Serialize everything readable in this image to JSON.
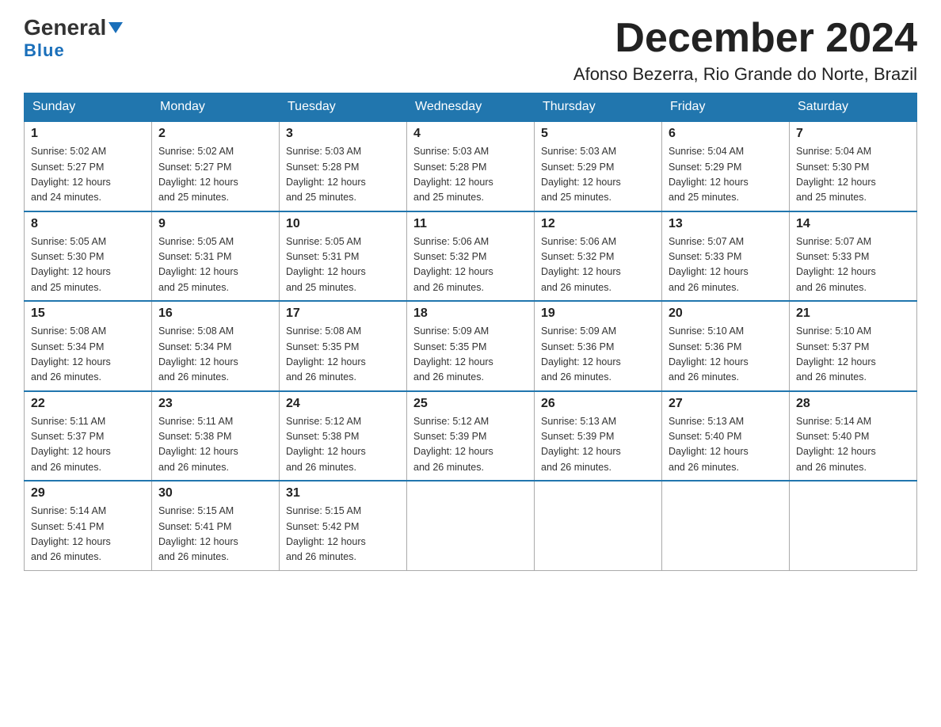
{
  "logo": {
    "line1": "General",
    "triangle": "▶",
    "line2": "Blue"
  },
  "header": {
    "month": "December 2024",
    "location": "Afonso Bezerra, Rio Grande do Norte, Brazil"
  },
  "days_of_week": [
    "Sunday",
    "Monday",
    "Tuesday",
    "Wednesday",
    "Thursday",
    "Friday",
    "Saturday"
  ],
  "weeks": [
    [
      {
        "num": "1",
        "sunrise": "5:02 AM",
        "sunset": "5:27 PM",
        "daylight": "12 hours and 24 minutes."
      },
      {
        "num": "2",
        "sunrise": "5:02 AM",
        "sunset": "5:27 PM",
        "daylight": "12 hours and 25 minutes."
      },
      {
        "num": "3",
        "sunrise": "5:03 AM",
        "sunset": "5:28 PM",
        "daylight": "12 hours and 25 minutes."
      },
      {
        "num": "4",
        "sunrise": "5:03 AM",
        "sunset": "5:28 PM",
        "daylight": "12 hours and 25 minutes."
      },
      {
        "num": "5",
        "sunrise": "5:03 AM",
        "sunset": "5:29 PM",
        "daylight": "12 hours and 25 minutes."
      },
      {
        "num": "6",
        "sunrise": "5:04 AM",
        "sunset": "5:29 PM",
        "daylight": "12 hours and 25 minutes."
      },
      {
        "num": "7",
        "sunrise": "5:04 AM",
        "sunset": "5:30 PM",
        "daylight": "12 hours and 25 minutes."
      }
    ],
    [
      {
        "num": "8",
        "sunrise": "5:05 AM",
        "sunset": "5:30 PM",
        "daylight": "12 hours and 25 minutes."
      },
      {
        "num": "9",
        "sunrise": "5:05 AM",
        "sunset": "5:31 PM",
        "daylight": "12 hours and 25 minutes."
      },
      {
        "num": "10",
        "sunrise": "5:05 AM",
        "sunset": "5:31 PM",
        "daylight": "12 hours and 25 minutes."
      },
      {
        "num": "11",
        "sunrise": "5:06 AM",
        "sunset": "5:32 PM",
        "daylight": "12 hours and 26 minutes."
      },
      {
        "num": "12",
        "sunrise": "5:06 AM",
        "sunset": "5:32 PM",
        "daylight": "12 hours and 26 minutes."
      },
      {
        "num": "13",
        "sunrise": "5:07 AM",
        "sunset": "5:33 PM",
        "daylight": "12 hours and 26 minutes."
      },
      {
        "num": "14",
        "sunrise": "5:07 AM",
        "sunset": "5:33 PM",
        "daylight": "12 hours and 26 minutes."
      }
    ],
    [
      {
        "num": "15",
        "sunrise": "5:08 AM",
        "sunset": "5:34 PM",
        "daylight": "12 hours and 26 minutes."
      },
      {
        "num": "16",
        "sunrise": "5:08 AM",
        "sunset": "5:34 PM",
        "daylight": "12 hours and 26 minutes."
      },
      {
        "num": "17",
        "sunrise": "5:08 AM",
        "sunset": "5:35 PM",
        "daylight": "12 hours and 26 minutes."
      },
      {
        "num": "18",
        "sunrise": "5:09 AM",
        "sunset": "5:35 PM",
        "daylight": "12 hours and 26 minutes."
      },
      {
        "num": "19",
        "sunrise": "5:09 AM",
        "sunset": "5:36 PM",
        "daylight": "12 hours and 26 minutes."
      },
      {
        "num": "20",
        "sunrise": "5:10 AM",
        "sunset": "5:36 PM",
        "daylight": "12 hours and 26 minutes."
      },
      {
        "num": "21",
        "sunrise": "5:10 AM",
        "sunset": "5:37 PM",
        "daylight": "12 hours and 26 minutes."
      }
    ],
    [
      {
        "num": "22",
        "sunrise": "5:11 AM",
        "sunset": "5:37 PM",
        "daylight": "12 hours and 26 minutes."
      },
      {
        "num": "23",
        "sunrise": "5:11 AM",
        "sunset": "5:38 PM",
        "daylight": "12 hours and 26 minutes."
      },
      {
        "num": "24",
        "sunrise": "5:12 AM",
        "sunset": "5:38 PM",
        "daylight": "12 hours and 26 minutes."
      },
      {
        "num": "25",
        "sunrise": "5:12 AM",
        "sunset": "5:39 PM",
        "daylight": "12 hours and 26 minutes."
      },
      {
        "num": "26",
        "sunrise": "5:13 AM",
        "sunset": "5:39 PM",
        "daylight": "12 hours and 26 minutes."
      },
      {
        "num": "27",
        "sunrise": "5:13 AM",
        "sunset": "5:40 PM",
        "daylight": "12 hours and 26 minutes."
      },
      {
        "num": "28",
        "sunrise": "5:14 AM",
        "sunset": "5:40 PM",
        "daylight": "12 hours and 26 minutes."
      }
    ],
    [
      {
        "num": "29",
        "sunrise": "5:14 AM",
        "sunset": "5:41 PM",
        "daylight": "12 hours and 26 minutes."
      },
      {
        "num": "30",
        "sunrise": "5:15 AM",
        "sunset": "5:41 PM",
        "daylight": "12 hours and 26 minutes."
      },
      {
        "num": "31",
        "sunrise": "5:15 AM",
        "sunset": "5:42 PM",
        "daylight": "12 hours and 26 minutes."
      },
      null,
      null,
      null,
      null
    ]
  ]
}
